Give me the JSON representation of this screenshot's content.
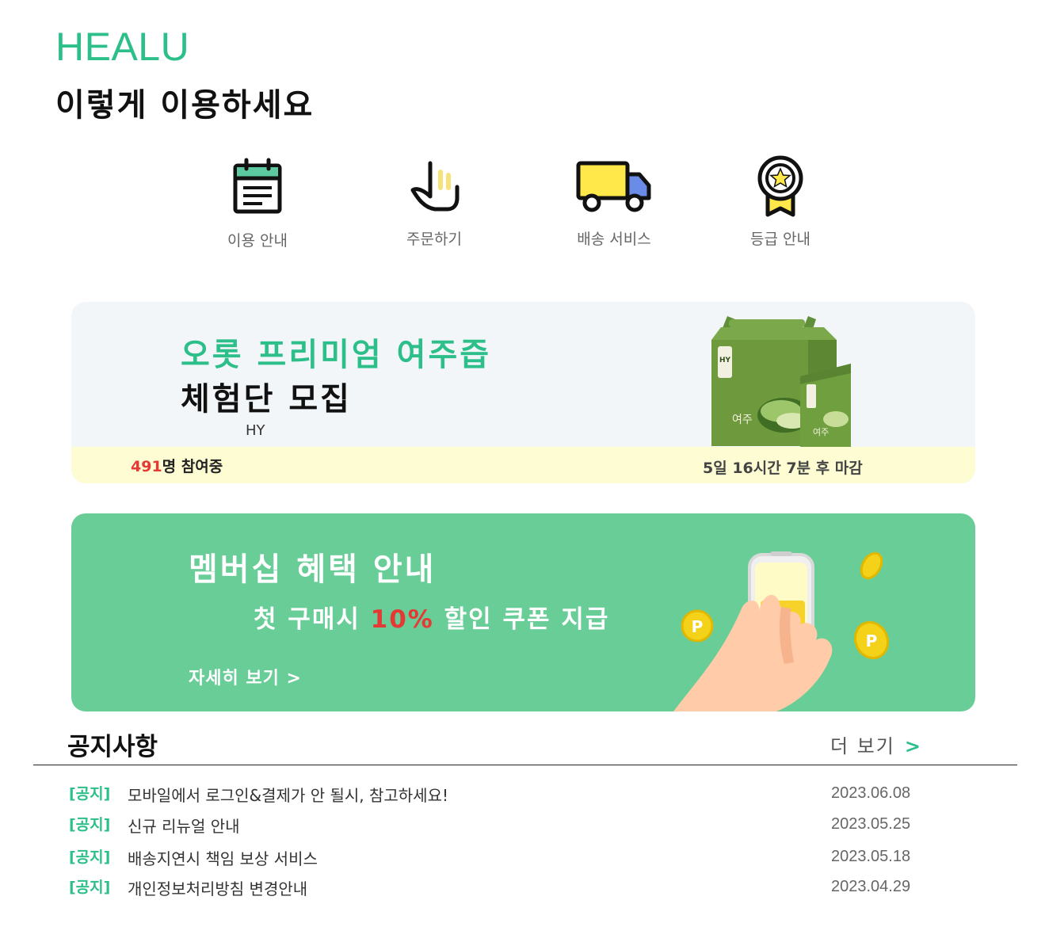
{
  "brand": "HEALU",
  "headline": "이렇게 이용하세요",
  "guides": [
    {
      "label": "이용 안내",
      "icon": "calendar-icon"
    },
    {
      "label": "주문하기",
      "icon": "tap-hand-icon"
    },
    {
      "label": "배송 서비스",
      "icon": "delivery-truck-icon"
    },
    {
      "label": "등급 안내",
      "icon": "medal-icon"
    }
  ],
  "trial": {
    "title": "오롯 프리미엄 여주즙",
    "subtitle": "체험단 모집",
    "brand": "HY",
    "count_num": "491",
    "count_suffix": "명 참여중",
    "deadline": "5일 16시간 7분 후 마감",
    "product": {
      "box_label": "여주",
      "pack_label": "여주",
      "logo": "HY 오롯"
    }
  },
  "membership": {
    "title": "멤버십 혜택 안내",
    "line_prefix": "첫 구매시 ",
    "line_pct": "10%",
    "line_suffix": " 할인 쿠폰 지급",
    "more": "자세히 보기 >",
    "coin_letter": "P"
  },
  "notice": {
    "title": "공지사항",
    "more_label": "더 보기",
    "more_arrow": ">",
    "items": [
      {
        "tag": "[공지]",
        "text": "모바일에서 로그인&결제가 안 될시, 참고하세요!",
        "date": "2023.06.08"
      },
      {
        "tag": "[공지]",
        "text": "신규 리뉴얼 안내",
        "date": "2023.05.25"
      },
      {
        "tag": "[공지]",
        "text": "배송지연시 책임 보상 서비스",
        "date": "2023.05.18"
      },
      {
        "tag": "[공지]",
        "text": "개인정보처리방침 변경안내",
        "date": "2023.04.29"
      }
    ]
  },
  "colors": {
    "accent": "#2dbf8a",
    "membership_bg": "#69cd97",
    "highlight": "#e53935",
    "trial_bar": "#fdfcd2"
  }
}
